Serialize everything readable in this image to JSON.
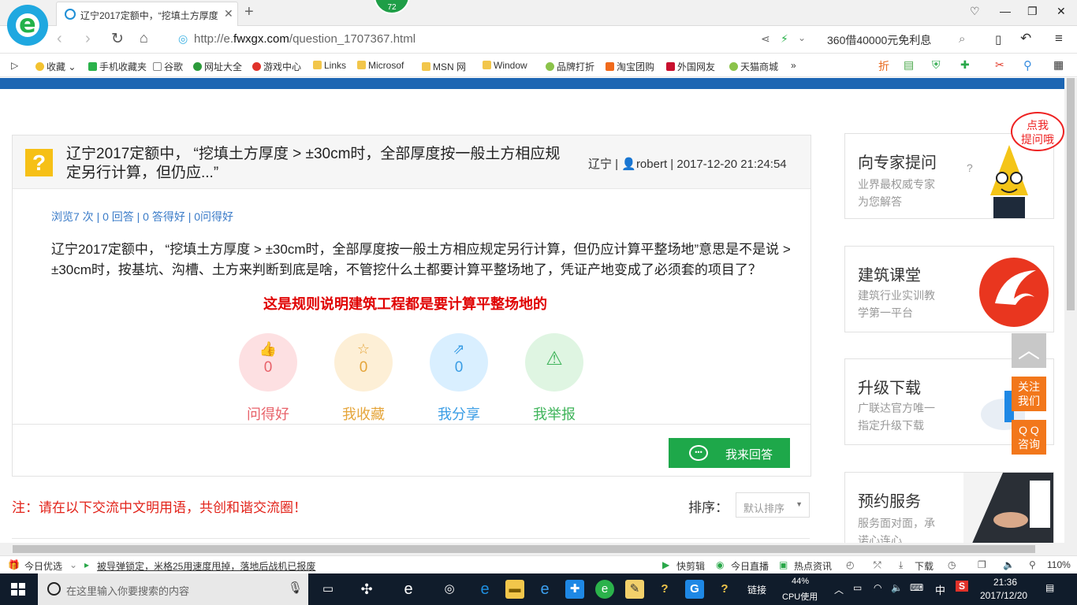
{
  "browser": {
    "tab_title": "辽宁2017定额中，“挖填土方厚度",
    "badge": "72",
    "url_prefix": "http://e.",
    "url_domain": "fwxgx.com",
    "url_path": "/question_1707367.html",
    "search_text": "360借40000元免利息",
    "bookmarks": [
      "收藏",
      "手机收藏夹",
      "谷歌",
      "网址大全",
      "游戏中心",
      "Links",
      "Microsof",
      "MSN 网",
      "Window",
      "品牌打折",
      "淘宝团购",
      "外国网友",
      "天猫商城"
    ],
    "more": "»"
  },
  "question": {
    "title": "辽宁2017定额中， “挖填土方厚度 > ±30cm时，全部厚度按一般土方相应规定另行计算，但仍应...”",
    "region": "辽宁",
    "author": "robert",
    "datetime": "2017-12-20 21:24:54",
    "stats": "浏览7 次 | 0 回答 | 0 答得好 | 0问得好",
    "body": "辽宁2017定额中， “挖填土方厚度 > ±30cm时，全部厚度按一般土方相应规定另行计算，但仍应计算平整场地”意思是不是说 > ±30cm时，按基坑、沟槽、土方来判断到底是啥，不管挖什么土都要计算平整场地了，凭证产地变成了必须套的项目了？",
    "annotation": "这是规则说明建筑工程都是要计算平整场地的",
    "actions": [
      {
        "label": "问得好",
        "count": "0",
        "icon": "thumbs-up-icon",
        "color": "#e8626a",
        "bg": "#fde0e2"
      },
      {
        "label": "我收藏",
        "count": "0",
        "icon": "star-icon",
        "color": "#e5a53a",
        "bg": "#fdefd6"
      },
      {
        "label": "我分享",
        "count": "0",
        "icon": "share-icon",
        "color": "#3a9de5",
        "bg": "#d9efff"
      },
      {
        "label": "我举报",
        "count": "",
        "icon": "warning-icon",
        "color": "#3fb45a",
        "bg": "#dff5e2"
      }
    ],
    "answer_button": "我来回答"
  },
  "comments": {
    "note": "注：请在以下交流中文明用语，共创和谐交流圈！",
    "sort_label": "排序：",
    "sort_value": "默认排序"
  },
  "sidebar": {
    "bubble": "点我\n提问哦",
    "cards": [
      {
        "title": "向专家提问",
        "line1": "业界最权威专家",
        "line2": "为您解答"
      },
      {
        "title": "建筑课堂",
        "line1": "建筑行业实训教",
        "line2": "学第一平台"
      },
      {
        "title": "升级下载",
        "line1": "广联达官方唯一",
        "line2": "指定升级下载"
      },
      {
        "title": "预约服务",
        "line1": "服务面对面，承",
        "line2": "诺心连心"
      }
    ],
    "follow": "关注\n我们",
    "qq": "Q Q\n咨询"
  },
  "statusbar": {
    "today": "今日优选",
    "news": "被导弹锁定，米格25用速度甩掉，落地后战机已报废",
    "items": [
      "快剪辑",
      "今日直播",
      "热点资讯",
      "下载"
    ],
    "zoom": "110%"
  },
  "taskbar": {
    "search_placeholder": "在这里输入你要搜索的内容",
    "link": "链接",
    "cpu_percent": "44%",
    "cpu_label": "CPU使用",
    "ime": "中",
    "time": "21:36",
    "date": "2017/12/20"
  }
}
